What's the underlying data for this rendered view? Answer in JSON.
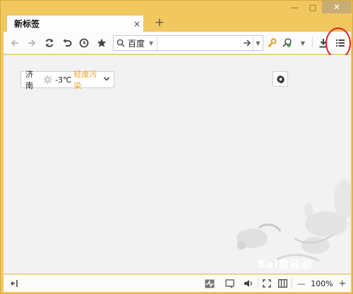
{
  "window": {
    "minimize_glyph": "—",
    "maximize_glyph": "□",
    "close_glyph": "✕"
  },
  "tab": {
    "title": "新标签",
    "close_glyph": "×"
  },
  "new_tab_glyph": "+",
  "toolbar": {
    "search_engine": "百度",
    "address_value": ""
  },
  "weather": {
    "city": "济南",
    "temperature": "-3℃",
    "pollution": "轻度污染",
    "pollution_color": "#f0a020"
  },
  "status": {
    "zoom": "100%",
    "zoom_out": "—",
    "zoom_in": "+"
  },
  "watermark": "Bai度经验",
  "colors": {
    "frame": "#f1c75f",
    "highlight_ring": "#e02020",
    "accent_key": "#e0a020",
    "accent_green": "#3a9a3a"
  }
}
